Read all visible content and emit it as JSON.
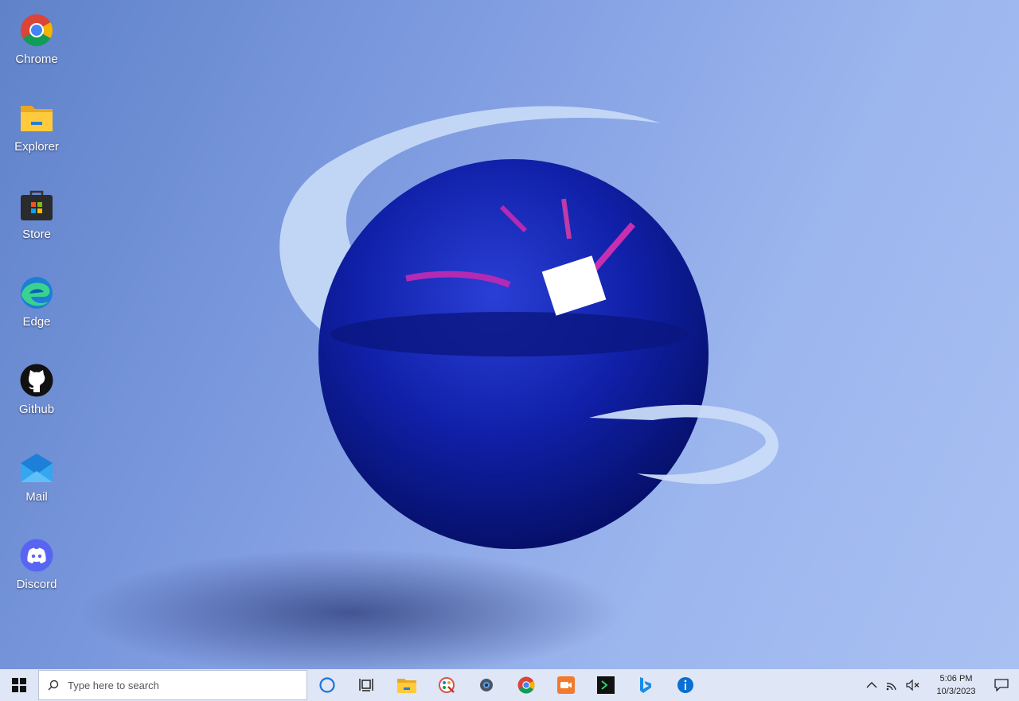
{
  "desktop": {
    "icons": [
      {
        "label": "Chrome",
        "icon": "chrome-icon"
      },
      {
        "label": "Explorer",
        "icon": "folder-icon"
      },
      {
        "label": "Store",
        "icon": "store-icon"
      },
      {
        "label": "Edge",
        "icon": "edge-icon"
      },
      {
        "label": "Github",
        "icon": "github-icon"
      },
      {
        "label": "Mail",
        "icon": "mail-icon"
      },
      {
        "label": "Discord",
        "icon": "discord-icon"
      }
    ]
  },
  "taskbar": {
    "search_placeholder": "Type here to search",
    "pinned": [
      "cortana-icon",
      "task-view-icon",
      "file-explorer-icon",
      "paint-icon",
      "settings-icon",
      "chrome-icon",
      "camera-icon",
      "terminal-icon",
      "bing-icon",
      "info-icon"
    ],
    "tray": [
      "show-hidden-icons-chevron",
      "network-icon",
      "volume-muted-icon"
    ],
    "clock": {
      "time": "5:06 PM",
      "date": "10/3/2023"
    }
  },
  "colors": {
    "taskbar_bg": "#dfe6f6",
    "desktop_bg": "#7e9be0",
    "sphere": "#0e1ea0"
  }
}
